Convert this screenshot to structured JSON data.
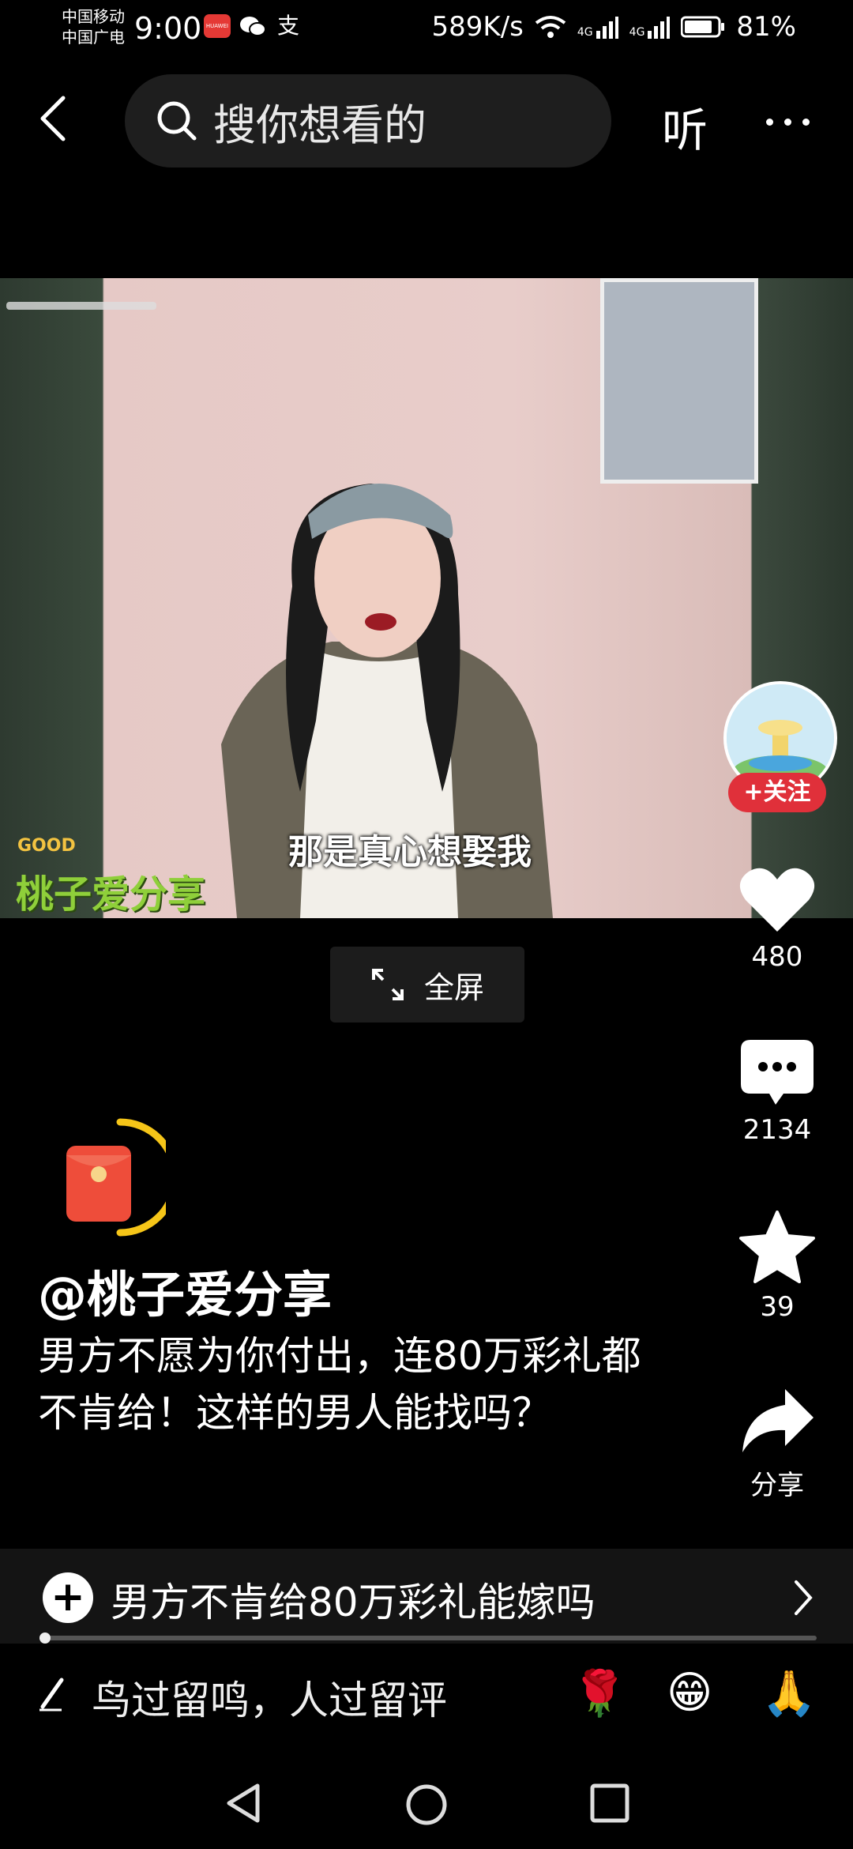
{
  "status_bar": {
    "carrier_1": "中国移动",
    "carrier_2": "中国广电",
    "time": "9:00",
    "app_1": "HUAWEI",
    "app_2": "微信",
    "app_3": "支",
    "speed": "589K/s",
    "signal_1": "4G",
    "signal_2": "4G",
    "battery": "81%"
  },
  "header": {
    "search_placeholder": "搜你想看的",
    "listen_label": "听"
  },
  "video": {
    "subtitle": "那是真心想娶我",
    "watermark": "桃子爱分享",
    "watermark_badge": "GOOD",
    "fullscreen_label": "全屏"
  },
  "rail": {
    "follow_label": "+关注",
    "likes": "480",
    "comments": "2134",
    "favorites": "39",
    "share_label": "分享"
  },
  "post": {
    "username": "@桃子爱分享",
    "description": "男方不愿为你付出，连80万彩礼都不肯给！这样的男人能找吗？"
  },
  "topic_bar": {
    "text": "男方不肯给80万彩礼能嫁吗",
    "progress": 0.01
  },
  "comment_bar": {
    "placeholder": "鸟过留鸣，人过留评",
    "emojis": [
      "🌹",
      "😁",
      "🙏"
    ]
  },
  "colors": {
    "accent_red": "#e0303a",
    "background": "#000000",
    "watermark_green": "#8fcf3a"
  }
}
